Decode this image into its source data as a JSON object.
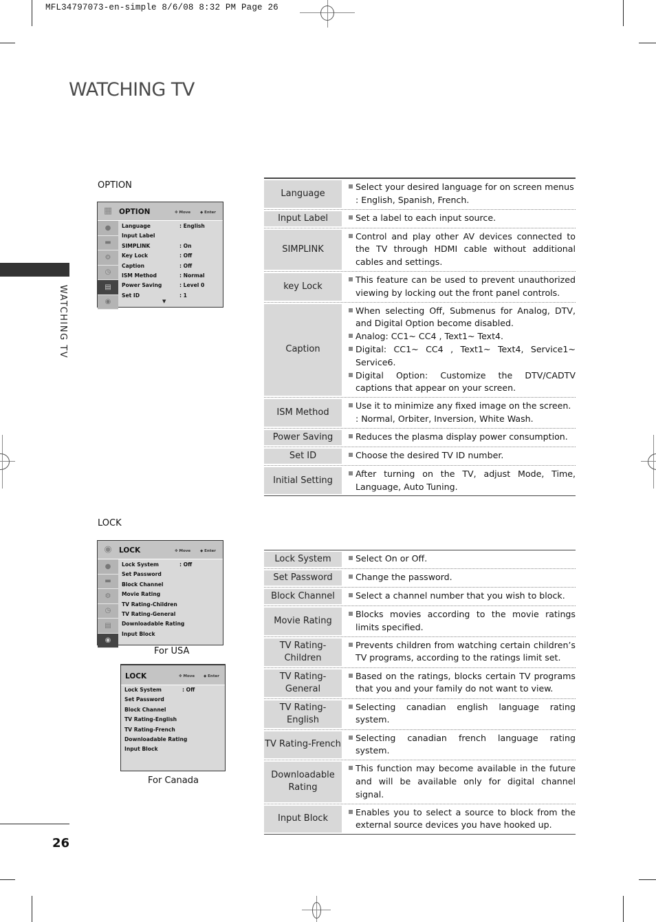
{
  "slug": "MFL34797073-en-simple  8/6/08 8:32 PM  Page 26",
  "page_title": "WATCHING TV",
  "side_tab_label": "WATCHING TV",
  "page_number": "26",
  "option_section": {
    "label": "OPTION",
    "osd": {
      "title": "OPTION",
      "move_hint": "Move",
      "enter_hint": "Enter",
      "icons": [
        "picture-icon",
        "tv-icon",
        "settings-icon",
        "time-icon",
        "option-icon",
        "lock-icon"
      ],
      "active_icon_index": 4,
      "items": [
        {
          "label": "Language",
          "value": ": English"
        },
        {
          "label": "Input Label",
          "value": ""
        },
        {
          "label": "SIMPLINK",
          "value": ": On"
        },
        {
          "label": "Key Lock",
          "value": ": Off"
        },
        {
          "label": "Caption",
          "value": ": Off"
        },
        {
          "label": "ISM Method",
          "value": ": Normal"
        },
        {
          "label": "Power Saving",
          "value": ": Level 0"
        },
        {
          "label": "Set ID",
          "value": ": 1"
        }
      ]
    },
    "table": [
      {
        "term": "Language",
        "items": [
          {
            "text": "Select your desired language for on screen menus",
            "sub": ": English, Spanish, French."
          }
        ]
      },
      {
        "term": "Input Label",
        "items": [
          {
            "text": "Set a label to each input source."
          }
        ]
      },
      {
        "term": "SIMPLINK",
        "items": [
          {
            "text": "Control and play other AV devices connected to the TV through HDMI cable without additional cables and settings."
          }
        ]
      },
      {
        "term": "key Lock",
        "items": [
          {
            "text": "This feature can be used to prevent unauthorized viewing by locking out the front panel controls."
          }
        ]
      },
      {
        "term": "Caption",
        "items": [
          {
            "text": "When selecting Off, Submenus for Analog, DTV, and Digital Option become disabled."
          },
          {
            "text": "Analog: CC1~ CC4 , Text1~ Text4."
          },
          {
            "text": "Digital: CC1~ CC4 , Text1~ Text4, Service1~ Service6."
          },
          {
            "text": "Digital Option: Customize the DTV/CADTV captions that appear on your screen."
          }
        ]
      },
      {
        "term": "ISM Method",
        "items": [
          {
            "text": "Use it to minimize any fixed image on the screen.",
            "sub": ": Normal, Orbiter, Inversion, White Wash."
          }
        ]
      },
      {
        "term": "Power Saving",
        "items": [
          {
            "text": "Reduces the plasma display power consumption."
          }
        ]
      },
      {
        "term": "Set ID",
        "items": [
          {
            "text": "Choose the desired TV ID number."
          }
        ]
      },
      {
        "term": "Initial Setting",
        "items": [
          {
            "text": "After turning on the TV, adjust Mode, Time, Language, Auto Tuning."
          }
        ]
      }
    ]
  },
  "lock_section": {
    "label": "LOCK",
    "osd_usa": {
      "title": "LOCK",
      "move_hint": "Move",
      "enter_hint": "Enter",
      "caption": "For USA",
      "icons": [
        "picture-icon",
        "tv-icon",
        "settings-icon",
        "time-icon",
        "option-icon",
        "lock-icon"
      ],
      "active_icon_index": 5,
      "items": [
        {
          "label": "Lock System",
          "value": ": Off"
        },
        {
          "label": "Set Password",
          "value": ""
        },
        {
          "label": "Block Channel",
          "value": ""
        },
        {
          "label": "Movie Rating",
          "value": ""
        },
        {
          "label": "TV Rating-Children",
          "value": ""
        },
        {
          "label": "TV Rating-General",
          "value": ""
        },
        {
          "label": "Downloadable Rating",
          "value": ""
        },
        {
          "label": "Input Block",
          "value": ""
        }
      ]
    },
    "osd_canada": {
      "title": "LOCK",
      "move_hint": "Move",
      "enter_hint": "Enter",
      "caption": "For Canada",
      "items": [
        {
          "label": "Lock System",
          "value": ": Off"
        },
        {
          "label": "Set Password",
          "value": ""
        },
        {
          "label": "Block Channel",
          "value": ""
        },
        {
          "label": "TV Rating-English",
          "value": ""
        },
        {
          "label": "TV Rating-French",
          "value": ""
        },
        {
          "label": "Downloadable Rating",
          "value": ""
        },
        {
          "label": "Input Block",
          "value": ""
        }
      ]
    },
    "table": [
      {
        "term": "Lock System",
        "items": [
          {
            "text": "Select On or Off."
          }
        ]
      },
      {
        "term": "Set Password",
        "items": [
          {
            "text": "Change the password."
          }
        ]
      },
      {
        "term": "Block Channel",
        "items": [
          {
            "text": "Select a channel number that you wish to block."
          }
        ]
      },
      {
        "term": "Movie Rating",
        "items": [
          {
            "text": "Blocks movies according to the movie ratings limits specified."
          }
        ]
      },
      {
        "term": "TV Rating-Children",
        "items": [
          {
            "text": "Prevents children from watching certain children’s TV programs, according to the ratings limit set."
          }
        ]
      },
      {
        "term": "TV Rating-General",
        "items": [
          {
            "text": "Based on the ratings, blocks certain TV programs that you and your family do not want to view."
          }
        ]
      },
      {
        "term": "TV Rating-English",
        "items": [
          {
            "text": "Selecting canadian english language rating system."
          }
        ]
      },
      {
        "term": "TV Rating-French",
        "items": [
          {
            "text": "Selecting canadian french language rating system."
          }
        ]
      },
      {
        "term": "Downloadable Rating",
        "items": [
          {
            "text": "This function may become available in the future and will be available only for digital channel signal."
          }
        ]
      },
      {
        "term": "Input Block",
        "items": [
          {
            "text": "Enables you to select a source to block from the external source devices you have hooked up."
          }
        ]
      }
    ]
  }
}
